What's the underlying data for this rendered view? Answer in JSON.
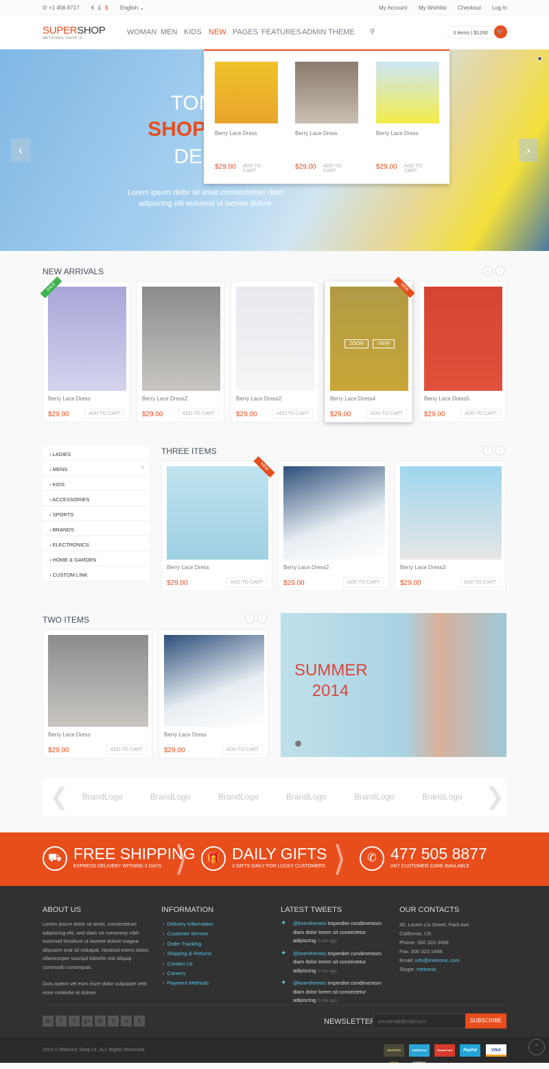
{
  "topbar": {
    "phone": "+1 456 6717",
    "currencies": [
      "€",
      "£",
      "$"
    ],
    "language": "English",
    "links": [
      "My Account",
      "My Wishlist",
      "Checkout",
      "Log In"
    ]
  },
  "header": {
    "logo_a": "SUPER",
    "logo_b": "SHOP",
    "logo_sub": "METRONIC SHOP UI",
    "nav": [
      "WOMAN",
      "MEN",
      "KIDS",
      "NEW",
      "PAGES",
      "FEATURES",
      "ADMIN THEME"
    ],
    "cart": "3 items",
    "cart_total": "$1260"
  },
  "mega": {
    "items": [
      {
        "title": "Berry Lace Dress",
        "price": "$29.00",
        "btn": "ADD TO CART"
      },
      {
        "title": "Berry Lace Dress",
        "price": "$29.00",
        "btn": "ADD TO CART"
      },
      {
        "title": "Berry Lace Dress",
        "price": "$29.00",
        "btn": "ADD TO CART"
      }
    ]
  },
  "hero": {
    "line1": "TONES",
    "line2": "SHOP UI FE",
    "line3": "DESIG",
    "text1": "Lorem ipsum dolor sit amet constectetuer diam",
    "text2": "adipiscing elit euismod ut laoreet dolore."
  },
  "new_arrivals": {
    "title": "NEW ARRIVALS",
    "zoom": "ZOOM",
    "view": "VIEW",
    "items": [
      {
        "title": "Berry Lace Dress",
        "price": "$29.00",
        "btn": "ADD TO CART",
        "badge": "SALE"
      },
      {
        "title": "Berry Lace Dress2",
        "price": "$29.00",
        "btn": "ADD TO CART"
      },
      {
        "title": "Berry Lace Dress2",
        "price": "$29.00",
        "btn": "ADD TO CART"
      },
      {
        "title": "Berry Lace Dress4",
        "price": "$29.00",
        "btn": "ADD TO CART",
        "badge": "NEW"
      },
      {
        "title": "Berry Lace Dress5",
        "price": "$29.00",
        "btn": "ADD TO CART"
      }
    ]
  },
  "sidebar": [
    "LADIES",
    "MENS",
    "KIDS",
    "ACCESSORIES",
    "SPORTS",
    "BRANDS",
    "ELECTRONICS",
    "HOME & GARDEN",
    "CUSTOM LINK"
  ],
  "three_items": {
    "title": "THREE ITEMS",
    "items": [
      {
        "title": "Berry Lace Dress",
        "price": "$29.00",
        "btn": "ADD TO CART",
        "badge": "NEW"
      },
      {
        "title": "Berry Lace Dress2",
        "price": "$29.00",
        "btn": "ADD TO CART"
      },
      {
        "title": "Berry Lace Dress3",
        "price": "$29.00",
        "btn": "ADD TO CART"
      }
    ]
  },
  "two_items": {
    "title": "TWO ITEMS",
    "items": [
      {
        "title": "Berry Lace Dress",
        "price": "$29.00",
        "btn": "ADD TO CART"
      },
      {
        "title": "Berry Lace Dress",
        "price": "$29.00",
        "btn": "ADD TO CART"
      }
    ]
  },
  "banner": {
    "line1": "SUMMER",
    "line2": "2014"
  },
  "brands": [
    "BrandLogo",
    "BrandLogo",
    "BrandLogo",
    "BrandLogo",
    "BrandLogo",
    "BrandLogo"
  ],
  "promo": [
    {
      "title": "FREE SHIPPING",
      "sub": "EXPRESS DELIVERY WITHING 3 DAYS",
      "icon": "truck-icon"
    },
    {
      "title": "DAILY GIFTS",
      "sub": "3 GIFTS DAILY FOR LUCKY CUSTOMERS",
      "icon": "gift-icon"
    },
    {
      "title": "477 505 8877",
      "sub": "24/7 CUSTOMER CARE AVAILABLE",
      "icon": "phone-icon"
    }
  ],
  "footer": {
    "about": {
      "title": "ABOUT US",
      "p1": "Lorem ipsum dolor sit amet, consectetuer adipiscing elit, sed diam sit nonummy nibh euismod tincidunt ut laoreet dolore magna aliquarm erat sit volutpat. Nostrud exerci tation ullamcorper suscipit lobortis nisl aliquip commodo consequat.",
      "p2": "Duis autem vel eum iriure dolor vulputate velit esse molestie at dolore."
    },
    "info": {
      "title": "INFORMATION",
      "links": [
        "Delivery Information",
        "Customer Service",
        "Order Tracking",
        "Shipping & Returns",
        "Contact Us",
        "Careers",
        "Payment Methods"
      ]
    },
    "tweets": {
      "title": "LATEST TWEETS",
      "items": [
        {
          "user": "@keenthemes",
          "text": "Imperdiet condimentum diam dolor lorem sit consectetur adipiscing",
          "time": "3 min ago"
        },
        {
          "user": "@keenthemes",
          "text": "Imperdiet condimentum diam dolor lorem sit consectetur adipiscing",
          "time": "3 min ago"
        },
        {
          "user": "@keenthemes",
          "text": "Imperdiet condimentum diam dolor lorem sit consectetur adipiscing",
          "time": "3 min ago"
        }
      ]
    },
    "contacts": {
      "title": "OUR CONTACTS",
      "addr1": "35, Lorem Lis Street, Park Ave",
      "addr2": "California, US",
      "phone": "Phone: 300 323 3456",
      "fax": "Fax: 300 323 1456",
      "email_label": "Email: ",
      "email": "info@metronic.com",
      "skype_label": "Skype: ",
      "skype": "metronic"
    },
    "newsletter": {
      "title": "NEWSLETTER",
      "placeholder": "youremail@mail.com",
      "btn": "SUBSCRIBE"
    },
    "copyright": "2014 © Metronic Shop UI. ALL Rights Reserved.",
    "payments": [
      "WESTERN UNION",
      "AMERICAN EXPRESS",
      "MasterCard",
      "PayPal",
      "VISA"
    ]
  },
  "colors": {
    "accent": "#e84d1c",
    "footer": "#313131",
    "link": "#57c8eb"
  }
}
